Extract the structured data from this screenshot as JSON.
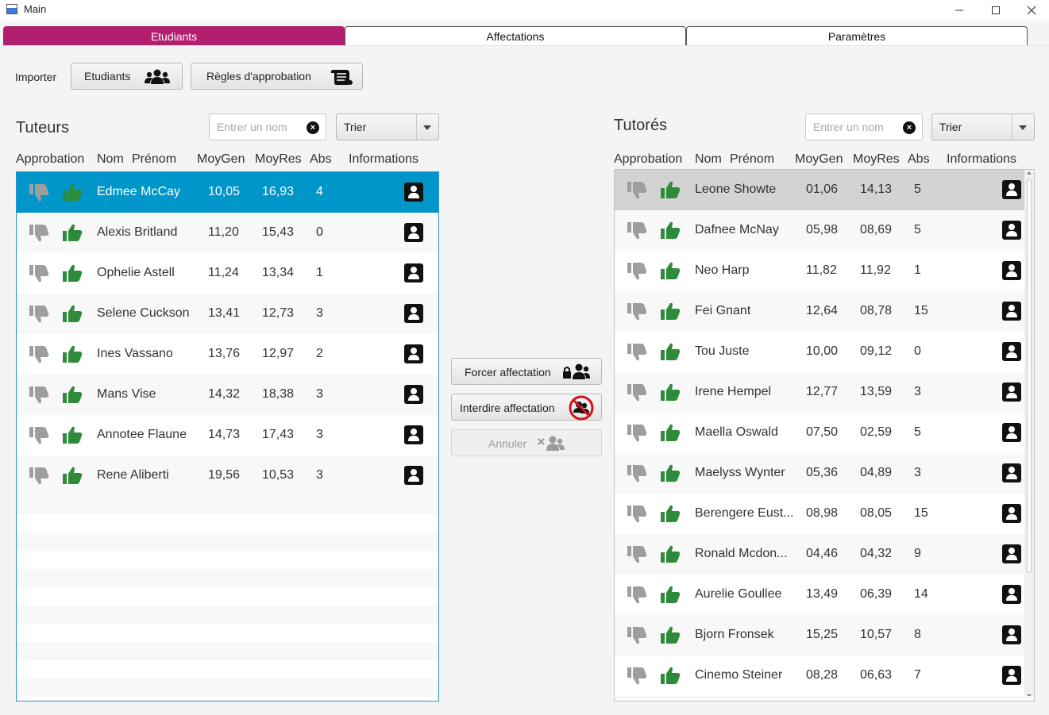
{
  "window": {
    "title": "Main"
  },
  "tabs": [
    {
      "label": "Etudiants",
      "active": true
    },
    {
      "label": "Affectations",
      "active": false
    },
    {
      "label": "Paramètres",
      "active": false
    }
  ],
  "importer": {
    "label": "Importer",
    "students_button": "Etudiants",
    "rules_button": "Règles d'approbation"
  },
  "colors": {
    "accent": "#b11f6e",
    "selection": "#0096c9",
    "thumb_up": "#2e8b3a",
    "thumb_down": "#9e9e9e"
  },
  "tuteurs": {
    "title": "Tuteurs",
    "search_placeholder": "Entrer un nom",
    "sort_label": "Trier",
    "headers": {
      "approbation": "Approbation",
      "nom": "Nom",
      "prenom": "Prénom",
      "moygen": "MoyGen",
      "moyres": "MoyRes",
      "abs": "Abs",
      "info": "Informations"
    },
    "rows": [
      {
        "name": "Edmee McCay",
        "moygen": "10,05",
        "moyres": "16,93",
        "abs": "4",
        "selected": true
      },
      {
        "name": "Alexis Britland",
        "moygen": "11,20",
        "moyres": "15,43",
        "abs": "0"
      },
      {
        "name": "Ophelie Astell",
        "moygen": "11,24",
        "moyres": "13,34",
        "abs": "1"
      },
      {
        "name": "Selene Cuckson",
        "moygen": "13,41",
        "moyres": "12,73",
        "abs": "3"
      },
      {
        "name": "Ines Vassano",
        "moygen": "13,76",
        "moyres": "12,97",
        "abs": "2"
      },
      {
        "name": "Mans Vise",
        "moygen": "14,32",
        "moyres": "18,38",
        "abs": "3"
      },
      {
        "name": "Annotee Flaune",
        "moygen": "14,73",
        "moyres": "17,43",
        "abs": "3"
      },
      {
        "name": "Rene Aliberti",
        "moygen": "19,56",
        "moyres": "10,53",
        "abs": "3"
      }
    ]
  },
  "actions": {
    "force": "Forcer affectation",
    "forbid": "Interdire affectation",
    "cancel": "Annuler"
  },
  "tutores": {
    "title": "Tutorés",
    "search_placeholder": "Entrer un nom",
    "sort_label": "Trier",
    "headers": {
      "approbation": "Approbation",
      "nom": "Nom",
      "prenom": "Prénom",
      "moygen": "MoyGen",
      "moyres": "MoyRes",
      "abs": "Abs",
      "info": "Informations"
    },
    "rows": [
      {
        "name": "Leone Showte",
        "moygen": "01,06",
        "moyres": "14,13",
        "abs": "5",
        "selected": true
      },
      {
        "name": "Dafnee McNay",
        "moygen": "05,98",
        "moyres": "08,69",
        "abs": "5"
      },
      {
        "name": "Neo Harp",
        "moygen": "11,82",
        "moyres": "11,92",
        "abs": "1"
      },
      {
        "name": "Fei Gnant",
        "moygen": "12,64",
        "moyres": "08,78",
        "abs": "15"
      },
      {
        "name": "Tou Juste",
        "moygen": "10,00",
        "moyres": "09,12",
        "abs": "0"
      },
      {
        "name": "Irene Hempel",
        "moygen": "12,77",
        "moyres": "13,59",
        "abs": "3"
      },
      {
        "name": "Maella Oswald",
        "moygen": "07,50",
        "moyres": "02,59",
        "abs": "5"
      },
      {
        "name": "Maelyss Wynter",
        "moygen": "05,36",
        "moyres": "04,89",
        "abs": "3"
      },
      {
        "name": "Berengere Eust...",
        "moygen": "08,98",
        "moyres": "08,05",
        "abs": "15"
      },
      {
        "name": "Ronald Mcdon...",
        "moygen": "04,46",
        "moyres": "04,32",
        "abs": "9"
      },
      {
        "name": "Aurelie Goullee",
        "moygen": "13,49",
        "moyres": "06,39",
        "abs": "14"
      },
      {
        "name": "Bjorn Fronsek",
        "moygen": "15,25",
        "moyres": "10,57",
        "abs": "8"
      },
      {
        "name": "Cinemo Steiner",
        "moygen": "08,28",
        "moyres": "06,63",
        "abs": "7"
      }
    ]
  }
}
